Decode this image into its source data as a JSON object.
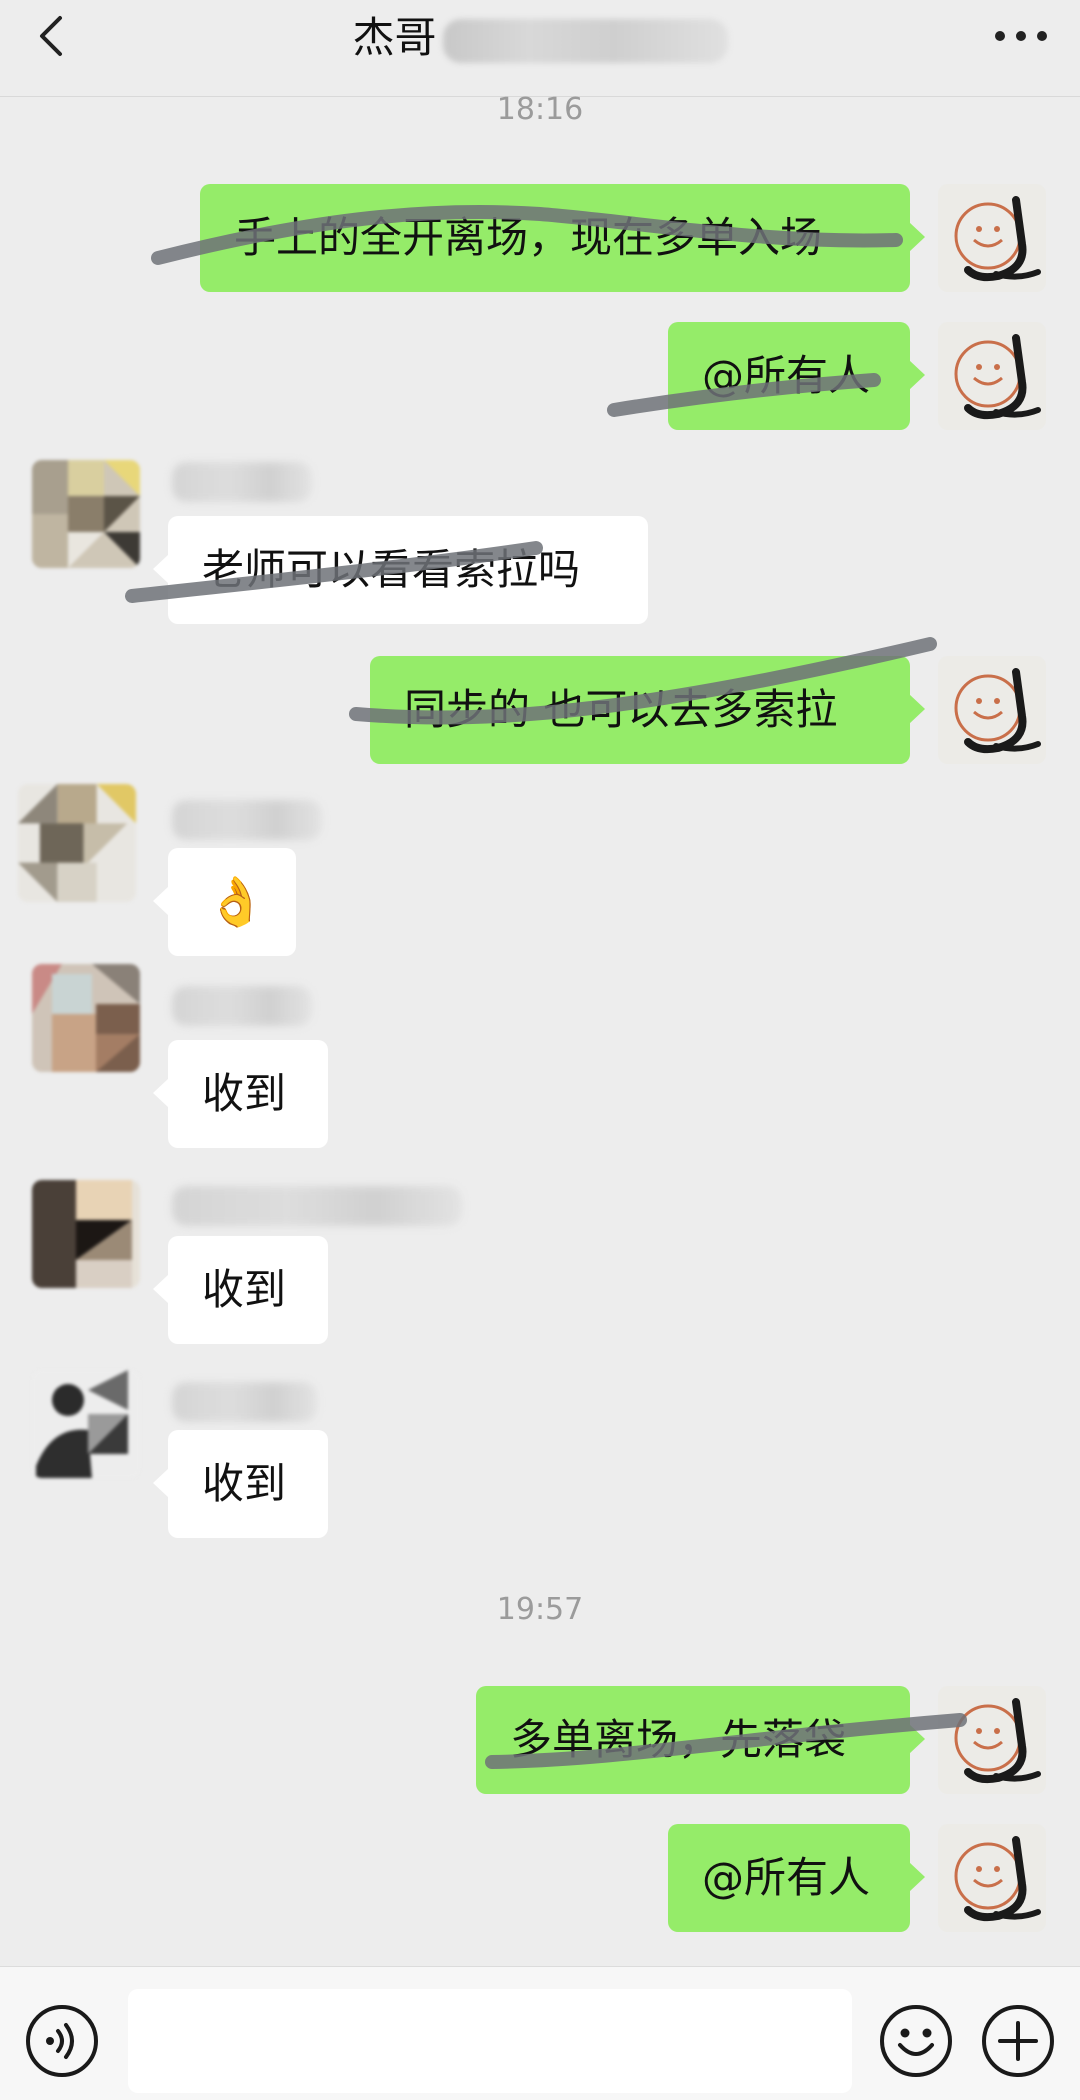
{
  "header": {
    "back_icon": "chevron-left-icon",
    "title": "杰哥",
    "more_icon": "ellipsis-icon"
  },
  "timestamps": [
    "18:16",
    "19:57"
  ],
  "messages": [
    {
      "from": "me",
      "text": "手上的全开离场，现在多单入场"
    },
    {
      "from": "me",
      "text": "@所有人"
    },
    {
      "from": "them",
      "text": "老师可以看看索拉吗"
    },
    {
      "from": "me",
      "text": "同步的 也可以去多索拉"
    },
    {
      "from": "them",
      "text": "👌"
    },
    {
      "from": "them",
      "text": "收到"
    },
    {
      "from": "them",
      "text": "收到"
    },
    {
      "from": "them",
      "text": "收到"
    },
    {
      "from": "me",
      "text": "多单离场，先落袋"
    },
    {
      "from": "me",
      "text": "@所有人"
    }
  ],
  "input_bar": {
    "voice_icon": "voice-icon",
    "text_value": "",
    "emoji_icon": "smiley-icon",
    "plus_icon": "plus-icon"
  },
  "colors": {
    "background": "#ededed",
    "my_bubble": "#95ec69",
    "their_bubble": "#ffffff",
    "timestamp": "#9b9b9b"
  }
}
